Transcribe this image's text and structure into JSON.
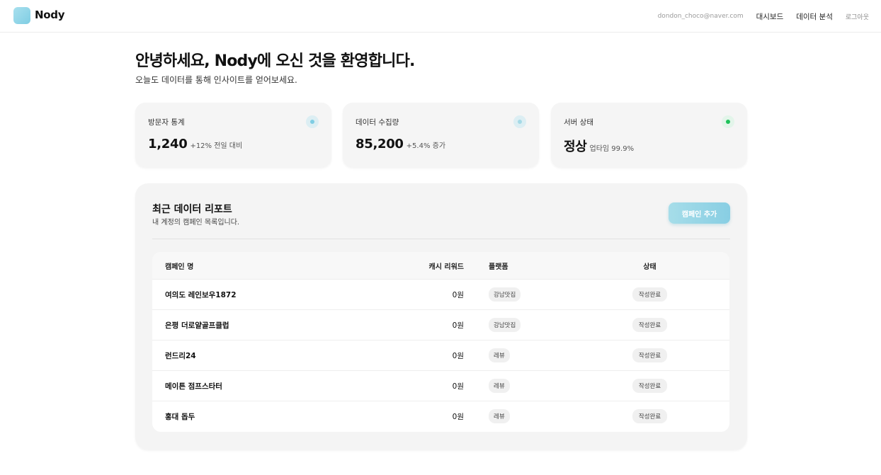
{
  "brand": {
    "name": "Nody"
  },
  "nav": {
    "email": "dondon_choco@naver.com",
    "dashboard": "대시보드",
    "analytics": "데이터 분석",
    "logout": "로그아웃"
  },
  "hero": {
    "title": "안녕하세요, Nody에 오신 것을 환영합니다.",
    "subtitle": "오늘도 데이터를 통해 인사이트를 얻어보세요."
  },
  "stats": [
    {
      "label": "방문자 통계",
      "value": "1,240",
      "delta": "+12% 전일 대비",
      "indicator_color": "#7fcde3"
    },
    {
      "label": "데이터 수집량",
      "value": "85,200",
      "delta": "+5.4% 증가",
      "indicator_color": "#a5d9e6"
    },
    {
      "label": "서버 상태",
      "value": "정상",
      "delta": "업타임 99.9%",
      "indicator_color": "#1fc25a"
    }
  ],
  "report": {
    "title": "최근 데이터 리포트",
    "subtitle": "내 계정의 캠페인 목록입니다.",
    "add_button": "캠페인 추가",
    "columns": {
      "name": "캠페인 명",
      "reward": "캐시 리워드",
      "platform": "플랫폼",
      "status": "상태"
    },
    "rows": [
      {
        "name": "여의도 레인보우1872",
        "reward": "0원",
        "platform": "강남맛집",
        "status": "작성완료"
      },
      {
        "name": "은평 더로얄골프클럽",
        "reward": "0원",
        "platform": "강남맛집",
        "status": "작성완료"
      },
      {
        "name": "런드리24",
        "reward": "0원",
        "platform": "레뷰",
        "status": "작성완료"
      },
      {
        "name": "메이튼 점프스타터",
        "reward": "0원",
        "platform": "레뷰",
        "status": "작성완료"
      },
      {
        "name": "홍대 돕두",
        "reward": "0원",
        "platform": "레뷰",
        "status": "작성완료"
      }
    ]
  },
  "colors": {
    "accent": "#88cee3",
    "success": "#1fc25a"
  }
}
